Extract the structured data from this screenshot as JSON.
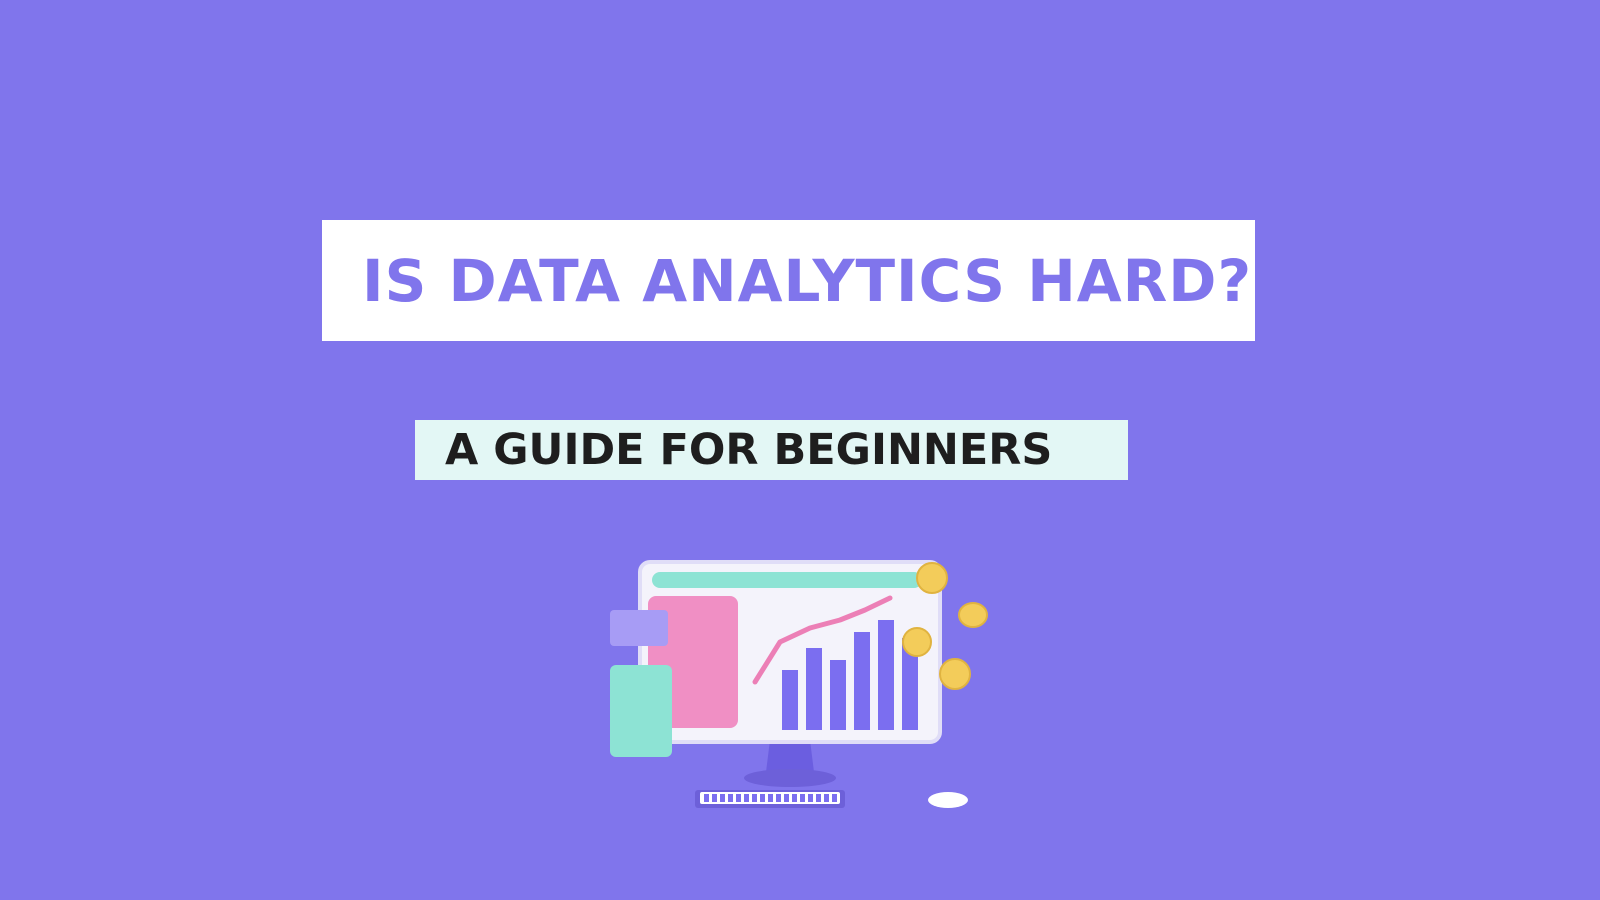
{
  "title": {
    "text": "IS DATA ANALYTICS HARD?",
    "color": "#8075ec",
    "box_color": "#ffffff"
  },
  "subtitle": {
    "text": "A GUIDE FOR BEGINNERS",
    "color": "#1e1e1e",
    "box_color": "#e3f7f5"
  },
  "background_color": "#8075ec",
  "illustration": {
    "icon": "computer-monitor-analytics-icon",
    "colors": {
      "screen": "#ffffff",
      "accent_teal": "#8de3d4",
      "accent_pink": "#f08fc4",
      "bars": "#7b6ef0",
      "trend_line": "#ec7fb6",
      "coins": "#f3cc5a"
    }
  }
}
